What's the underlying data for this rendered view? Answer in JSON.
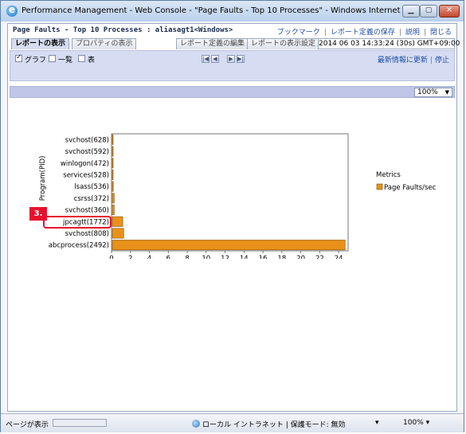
{
  "window": {
    "title": "Performance Management - Web Console - \"Page Faults - Top 10 Processes\" - Windows Internet Explorer",
    "min_glyph": "▁",
    "max_glyph": "▢",
    "close_glyph": "✕"
  },
  "header": {
    "page_title": "Page Faults - Top 10 Processes : aliasagt1<Windows>",
    "links": [
      "ブックマーク",
      "レポート定義の保存",
      "説明",
      "閉じる"
    ]
  },
  "tabs": {
    "left": [
      "レポートの表示",
      "プロパティの表示"
    ],
    "right": [
      "レポート定義の編集",
      "レポートの表示設定"
    ],
    "datetime": "2014 06 03 14:33:24 (30s) GMT+09:00"
  },
  "toolbar": {
    "checkboxes": [
      {
        "label": "グラフ",
        "checked": true
      },
      {
        "label": "一覧",
        "checked": false
      },
      {
        "label": "表",
        "checked": false
      }
    ],
    "nav_glyphs": [
      "|◀",
      "◀",
      "▶",
      "▶|"
    ],
    "refresh_links": [
      "最新情報に更新",
      "停止"
    ]
  },
  "zoom": {
    "value": "100%",
    "arrow": "▼"
  },
  "chart_data": {
    "type": "bar",
    "orientation": "horizontal",
    "categories": [
      "svchost(628)",
      "svchost(592)",
      "winlogon(472)",
      "services(528)",
      "lsass(536)",
      "csrss(372)",
      "svchost(360)",
      "jpcagtt(1772)",
      "svchost(808)",
      "abcprocess(2492)"
    ],
    "values": [
      0.05,
      0.05,
      0.05,
      0.05,
      0.1,
      0.2,
      0.2,
      1.1,
      1.2,
      24.6
    ],
    "xlabel": "Page Faults/sec",
    "ylabel": "Program(PID)",
    "xticks": [
      "0",
      "2",
      "4",
      "6",
      "8",
      "10",
      "12",
      "14",
      "16",
      "18",
      "20",
      "22",
      "24"
    ],
    "xlim": [
      0,
      25
    ],
    "legend_title": "Metrics",
    "legend_entry": "Page Faults/sec",
    "bar_color": "#e8911a",
    "grid": false,
    "legend_position": "right"
  },
  "callout": {
    "label": "3.",
    "color": "#e8112d"
  },
  "statusbar": {
    "left": "ページが表示",
    "zone": "ローカル イントラネット | 保護モード: 無効",
    "tool": "▾",
    "zoom": "100%  ▾"
  }
}
